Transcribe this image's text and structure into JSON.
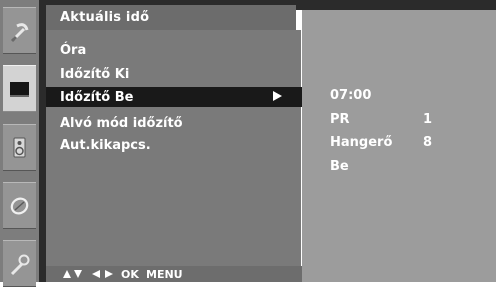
{
  "menu": {
    "title": "Aktuális idő",
    "items": [
      {
        "label": "Óra"
      },
      {
        "label": "Időzítő Ki"
      },
      {
        "label": "Időzítő Be",
        "selected": true
      },
      {
        "label": "Alvó mód időzítő"
      },
      {
        "label": "Aut.kikapcs."
      }
    ]
  },
  "help": {
    "ok_label": "OK",
    "menu_label": "MENU"
  },
  "detail": {
    "time": "07:00",
    "pr_label": "PR",
    "pr_value": "1",
    "volume_label": "Hangerő",
    "volume_value": "8",
    "state": "Be"
  },
  "rail_icons": [
    "satellite-icon",
    "picture-icon",
    "speaker-icon",
    "disc-icon",
    "wrench-icon"
  ],
  "colors": {
    "selection": "#191919",
    "panel": "#7a7a7a",
    "pane": "#9c9c9c"
  }
}
